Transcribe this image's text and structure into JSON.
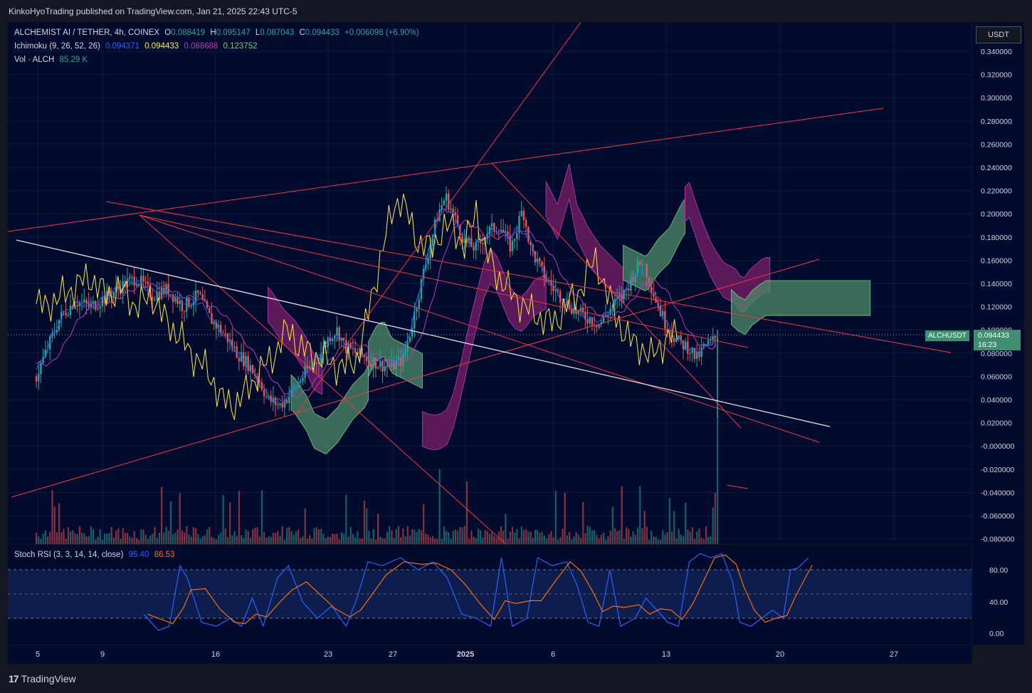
{
  "publisher": "KinkoHyoTrading published on TradingView.com, Jan 21, 2025 22:43 UTC-5",
  "legend": {
    "symbol": "ALCHEMIST AI / TETHER, 4h, COINEX",
    "o_label": "O",
    "o": "0.088419",
    "h_label": "H",
    "h": "0.095147",
    "l_label": "L",
    "l": "0.087043",
    "c_label": "C",
    "c": "0.094433",
    "change": "+0.006098 (+6.90%)",
    "ichimoku_label": "Ichimoku (9, 26, 52, 26)",
    "ichimoku_values": [
      "0.094371",
      "0.094433",
      "0.088688",
      "0.123752"
    ],
    "vol_label": "Vol · ALCH",
    "vol_value": "85.29 K"
  },
  "stoch_legend": {
    "label": "Stoch RSI (3, 3, 14, 14, close)",
    "k": "95.40",
    "d": "86.53"
  },
  "currency": "USDT",
  "ticker": "ALCHUSDT",
  "last_price": "0.094433",
  "countdown": "16:23",
  "footer": "TradingView",
  "colors": {
    "bg": "#020b2d",
    "up": "#26a69a",
    "down": "#ef5350",
    "tenkan": "#2962ff",
    "chikou": "#ffeb3b",
    "cloud_bull": "#4e8c6a",
    "cloud_bear": "#7b1f6a",
    "trendline": "#f23645",
    "white_line": "#e0e0e0",
    "stoch_k": "#2962ff",
    "stoch_d": "#ff6d00"
  },
  "chart_data": [
    {
      "type": "candlestick",
      "title": "",
      "x_ticks": [
        "5",
        "9",
        "16",
        "23",
        "27",
        "2025",
        "6",
        "13",
        "20",
        "27"
      ],
      "y_ticks": [
        "0.340000",
        "0.320000",
        "0.300000",
        "0.280000",
        "0.260000",
        "0.240000",
        "0.220000",
        "0.200000",
        "0.180000",
        "0.160000",
        "0.140000",
        "0.120000",
        "0.100000",
        "0.080000",
        "0.060000",
        "0.040000",
        "0.020000",
        "-0.000000",
        "-0.020000",
        "-0.040000",
        "-0.060000",
        "-0.080000"
      ],
      "ylim": [
        -0.08,
        0.345
      ],
      "price_path": [
        [
          0,
          0.06
        ],
        [
          0.012,
          0.08
        ],
        [
          0.03,
          0.11
        ],
        [
          0.05,
          0.125
        ],
        [
          0.07,
          0.12
        ],
        [
          0.095,
          0.13
        ],
        [
          0.115,
          0.14
        ],
        [
          0.13,
          0.145
        ],
        [
          0.15,
          0.13
        ],
        [
          0.17,
          0.135
        ],
        [
          0.19,
          0.12
        ],
        [
          0.21,
          0.13
        ],
        [
          0.225,
          0.11
        ],
        [
          0.245,
          0.095
        ],
        [
          0.26,
          0.08
        ],
        [
          0.275,
          0.07
        ],
        [
          0.29,
          0.055
        ],
        [
          0.3,
          0.04
        ],
        [
          0.315,
          0.035
        ],
        [
          0.33,
          0.045
        ],
        [
          0.35,
          0.065
        ],
        [
          0.365,
          0.075
        ],
        [
          0.38,
          0.095
        ],
        [
          0.39,
          0.1
        ],
        [
          0.4,
          0.085
        ],
        [
          0.415,
          0.08
        ],
        [
          0.43,
          0.075
        ],
        [
          0.445,
          0.07
        ],
        [
          0.46,
          0.068
        ],
        [
          0.475,
          0.075
        ],
        [
          0.485,
          0.1
        ],
        [
          0.495,
          0.13
        ],
        [
          0.505,
          0.16
        ],
        [
          0.52,
          0.2
        ],
        [
          0.53,
          0.215
        ],
        [
          0.54,
          0.2
        ],
        [
          0.555,
          0.175
        ],
        [
          0.57,
          0.17
        ],
        [
          0.585,
          0.185
        ],
        [
          0.6,
          0.19
        ],
        [
          0.615,
          0.17
        ],
        [
          0.63,
          0.205
        ],
        [
          0.64,
          0.17
        ],
        [
          0.655,
          0.15
        ],
        [
          0.67,
          0.135
        ],
        [
          0.685,
          0.125
        ],
        [
          0.7,
          0.115
        ],
        [
          0.715,
          0.11
        ],
        [
          0.73,
          0.105
        ],
        [
          0.745,
          0.12
        ],
        [
          0.76,
          0.13
        ],
        [
          0.775,
          0.15
        ],
        [
          0.785,
          0.16
        ],
        [
          0.8,
          0.13
        ],
        [
          0.815,
          0.105
        ],
        [
          0.83,
          0.09
        ],
        [
          0.845,
          0.085
        ],
        [
          0.855,
          0.075
        ],
        [
          0.865,
          0.085
        ],
        [
          0.875,
          0.09
        ],
        [
          0.882,
          0.094433
        ]
      ],
      "indicators": [
        "Ichimoku (9, 26, 52, 26)",
        "Vol · ALCH"
      ]
    },
    {
      "type": "line",
      "title": "Stoch RSI (3, 3, 14, 14, close)",
      "y_ticks": [
        "80.00",
        "40.00",
        "0.00"
      ],
      "ylim": [
        -5,
        105
      ],
      "band": [
        20,
        80
      ],
      "k_path": [
        [
          0.08,
          25
        ],
        [
          0.1,
          5
        ],
        [
          0.115,
          10
        ],
        [
          0.13,
          85
        ],
        [
          0.14,
          70
        ],
        [
          0.16,
          15
        ],
        [
          0.18,
          10
        ],
        [
          0.2,
          20
        ],
        [
          0.215,
          10
        ],
        [
          0.23,
          45
        ],
        [
          0.245,
          10
        ],
        [
          0.265,
          70
        ],
        [
          0.28,
          85
        ],
        [
          0.3,
          40
        ],
        [
          0.32,
          20
        ],
        [
          0.34,
          35
        ],
        [
          0.36,
          10
        ],
        [
          0.375,
          45
        ],
        [
          0.39,
          90
        ],
        [
          0.41,
          85
        ],
        [
          0.435,
          95
        ],
        [
          0.46,
          80
        ],
        [
          0.48,
          90
        ],
        [
          0.5,
          70
        ],
        [
          0.52,
          25
        ],
        [
          0.54,
          20
        ],
        [
          0.56,
          10
        ],
        [
          0.575,
          95
        ],
        [
          0.59,
          10
        ],
        [
          0.61,
          20
        ],
        [
          0.625,
          95
        ],
        [
          0.645,
          85
        ],
        [
          0.665,
          90
        ],
        [
          0.68,
          60
        ],
        [
          0.695,
          15
        ],
        [
          0.71,
          10
        ],
        [
          0.725,
          80
        ],
        [
          0.74,
          10
        ],
        [
          0.76,
          20
        ],
        [
          0.775,
          45
        ],
        [
          0.79,
          30
        ],
        [
          0.805,
          15
        ],
        [
          0.82,
          10
        ],
        [
          0.835,
          90
        ],
        [
          0.85,
          100
        ],
        [
          0.865,
          95
        ],
        [
          0.88,
          100
        ],
        [
          0.895,
          65
        ],
        [
          0.905,
          15
        ],
        [
          0.92,
          10
        ],
        [
          0.935,
          20
        ],
        [
          0.95,
          30
        ],
        [
          0.965,
          20
        ],
        [
          0.975,
          80
        ],
        [
          0.985,
          82
        ],
        [
          1.0,
          95
        ]
      ]
    }
  ]
}
